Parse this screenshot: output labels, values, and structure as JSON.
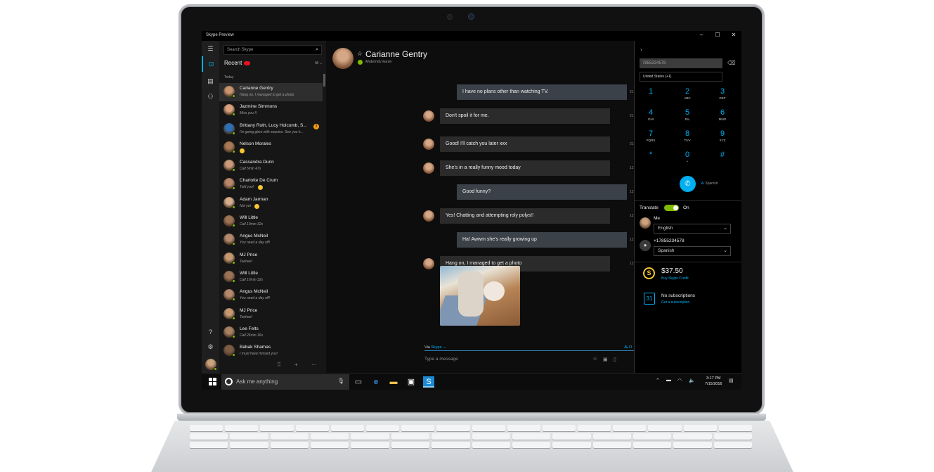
{
  "window": {
    "title": "Skype Preview",
    "controls": [
      "–",
      "☐",
      "✕"
    ]
  },
  "rail": {
    "menu_icon": "hamburger-icon",
    "items": [
      "chats-icon",
      "contacts-icon",
      "people-icon"
    ],
    "help": "?",
    "settings": "gear-icon"
  },
  "search": {
    "placeholder": "Search Skype"
  },
  "recent": {
    "label": "Recent",
    "filter": "All ⌄",
    "group": "Today"
  },
  "conversations": [
    {
      "name": "Carianne Gentry",
      "sub": "Hang on, I managed to get a photo",
      "selected": true
    },
    {
      "name": "Jazmine Simmons",
      "sub": "Miss you X"
    },
    {
      "name": "Brittany Roth, Lucy Holcomb, S...",
      "sub": "I'm going glam with sequins. See you h...",
      "badge": "3"
    },
    {
      "name": "Nelson Morales",
      "sub": ""
    },
    {
      "name": "Cassandra Dunn",
      "sub": "Call 5min 47s"
    },
    {
      "name": "Charlotte De Crum",
      "sub": "Told you!"
    },
    {
      "name": "Adam Jarman",
      "sub": "Not yet"
    },
    {
      "name": "Will Little",
      "sub": "Call 10min 32s"
    },
    {
      "name": "Angus McNeil",
      "sub": "You need a day off!"
    },
    {
      "name": "MJ Price",
      "sub": "Teehee!"
    },
    {
      "name": "Will Little",
      "sub": "Call 10min 32s"
    },
    {
      "name": "Angus McNeil",
      "sub": "You need a day off!"
    },
    {
      "name": "MJ Price",
      "sub": "Teehee!"
    },
    {
      "name": "Lee Felts",
      "sub": "Call 26min 16s"
    },
    {
      "name": "Babak Shamas",
      "sub": "I must have missed you!"
    }
  ],
  "list_footer": [
    "⠿",
    "+",
    "···"
  ],
  "chat": {
    "contact": "Carianne Gentry",
    "status": "Maternity leave",
    "messages": [
      {
        "dir": "out",
        "text": "I have no plans other than watching TV.",
        "time": "21"
      },
      {
        "dir": "in",
        "text": "Don't spoil it for me.",
        "time": "21"
      },
      {
        "dir": "in",
        "text": "Good! I'll catch you later xxx",
        "time": "21"
      },
      {
        "dir": "in",
        "text": "She's in a really funny mood today",
        "time": "12"
      },
      {
        "dir": "out",
        "text": "Good funny?",
        "time": "12"
      },
      {
        "dir": "in",
        "text": "Yes! Chatting and attempting roly polys!!",
        "time": "12"
      },
      {
        "dir": "out",
        "text": "Ha! Awwm she's really growing up",
        "time": "12"
      },
      {
        "dir": "in",
        "text": "Hang on, I managed to get a photo",
        "time": "12"
      }
    ],
    "via_label": "Via",
    "via_service": "Skype ⌄",
    "composer_placeholder": "Type a message",
    "translator_label": "O"
  },
  "dialpad": {
    "number": "7855234578",
    "country": "United States (+1)",
    "keys": [
      {
        "d": "1",
        "l": ""
      },
      {
        "d": "2",
        "l": "ABC"
      },
      {
        "d": "3",
        "l": "DEF"
      },
      {
        "d": "4",
        "l": "GHI"
      },
      {
        "d": "5",
        "l": "JKL"
      },
      {
        "d": "6",
        "l": "MNO"
      },
      {
        "d": "7",
        "l": "PQRS"
      },
      {
        "d": "8",
        "l": "TUV"
      },
      {
        "d": "9",
        "l": "XYZ"
      },
      {
        "d": "*",
        "l": ""
      },
      {
        "d": "0",
        "l": "+"
      },
      {
        "d": "#",
        "l": ""
      }
    ],
    "call_language": "Spanish",
    "translate_label": "Translate",
    "translate_state": "On",
    "me_label": "Me",
    "me_language": "English",
    "other_label": "+17855234578",
    "other_language": "Spanish",
    "credit_amount": "$37.50",
    "credit_link": "Buy Skype Credit",
    "subs_label": "No subscriptions",
    "subs_link": "Get a subscription"
  },
  "taskbar": {
    "search_placeholder": "Ask me anything",
    "time": "3:17 PM",
    "date": "7/15/2016"
  },
  "colors": {
    "accent": "#00aff0",
    "online": "#7fba00",
    "unread": "#e81123"
  }
}
